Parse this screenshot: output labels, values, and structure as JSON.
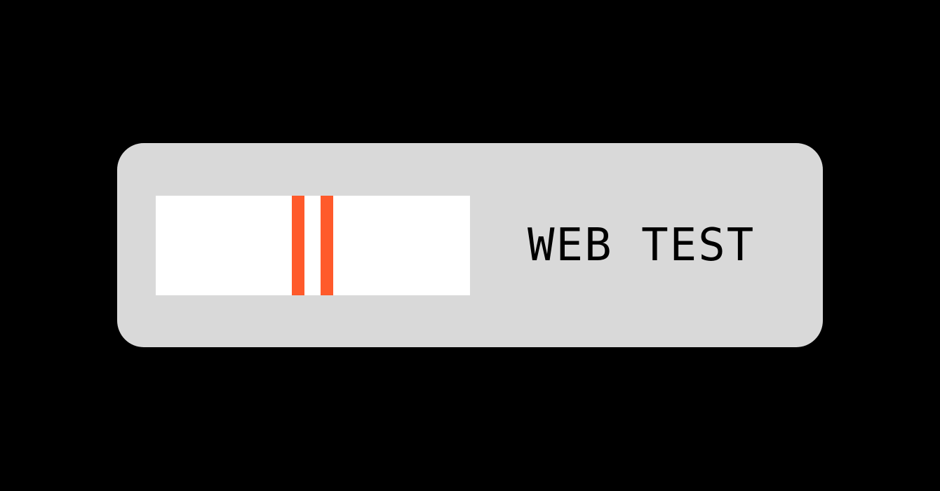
{
  "title": "WEB TEST",
  "colors": {
    "background": "#000000",
    "card": "#d9d9d9",
    "strip": "#ffffff",
    "line": "#ff5a2b",
    "text": "#000000"
  },
  "icons": {
    "test_strip": "test-strip-icon"
  },
  "test_strip": {
    "line_count": 2
  }
}
